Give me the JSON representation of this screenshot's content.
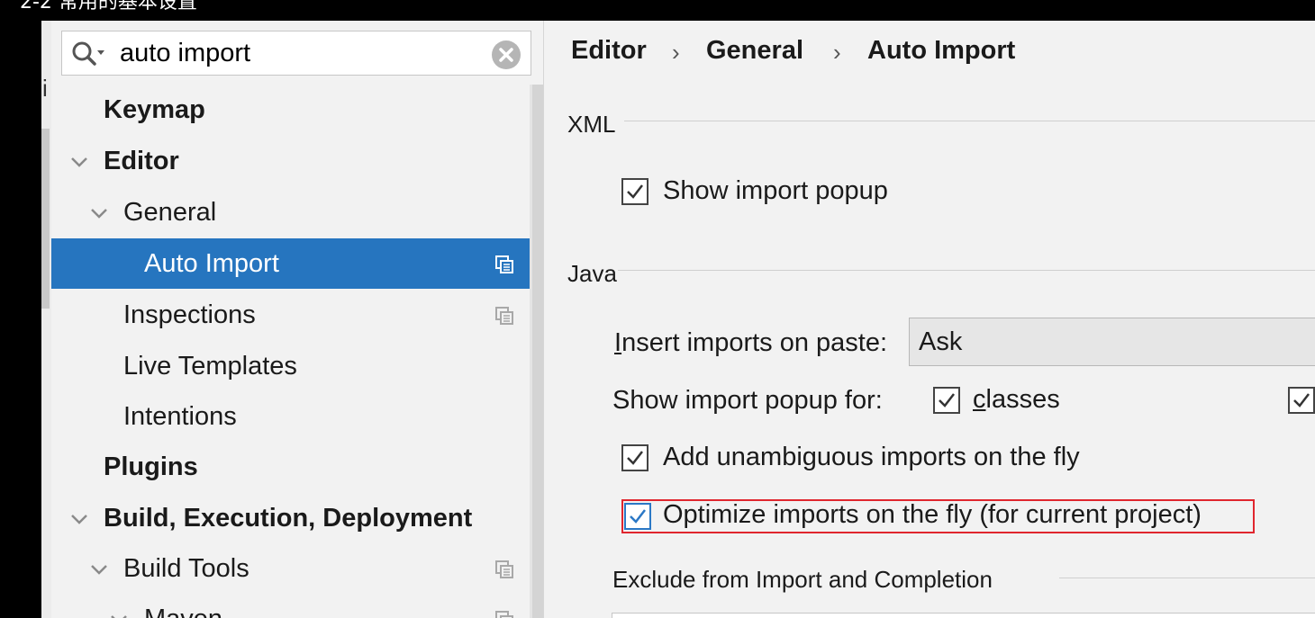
{
  "video_title": "2-2 常用的基本设置",
  "search": {
    "value": "auto import",
    "icon": "search-icon",
    "clear_icon": "clear-icon"
  },
  "tree": [
    {
      "id": "keymap",
      "label": "Keymap"
    },
    {
      "id": "editor",
      "label": "Editor"
    },
    {
      "id": "general",
      "label": "General"
    },
    {
      "id": "auto-import",
      "label": "Auto Import"
    },
    {
      "id": "inspections",
      "label": "Inspections"
    },
    {
      "id": "live-templates",
      "label": "Live Templates"
    },
    {
      "id": "intentions",
      "label": "Intentions"
    },
    {
      "id": "plugins",
      "label": "Plugins"
    },
    {
      "id": "build",
      "label": "Build, Execution, Deployment"
    },
    {
      "id": "build-tools",
      "label": "Build Tools"
    },
    {
      "id": "maven",
      "label": "Maven"
    }
  ],
  "breadcrumb": {
    "items": [
      "Editor",
      "General",
      "Auto Import"
    ],
    "separator": "›"
  },
  "xml_section": {
    "title": "XML",
    "show_import_popup": {
      "label": "Show import popup",
      "checked": true
    }
  },
  "java_section": {
    "title": "Java",
    "insert_imports_label_first": "I",
    "insert_imports_label_rest": "nsert imports on paste:",
    "insert_imports_value": "Ask",
    "show_popup_for_label": "Show import popup for:",
    "classes": {
      "label_first": "c",
      "label_rest": "lasses",
      "checked": true
    },
    "add_unambiguous": {
      "label": "Add unambiguous imports on the fly",
      "checked": true
    },
    "optimize_imports": {
      "label": "Optimize imports on the fly (for current project)",
      "checked": true
    }
  },
  "exclude_section": {
    "title": "Exclude from Import and Completion"
  },
  "colors": {
    "selection": "#2675bf",
    "highlight": "#e0262e",
    "checkbox_focus": "#2b78c6"
  }
}
